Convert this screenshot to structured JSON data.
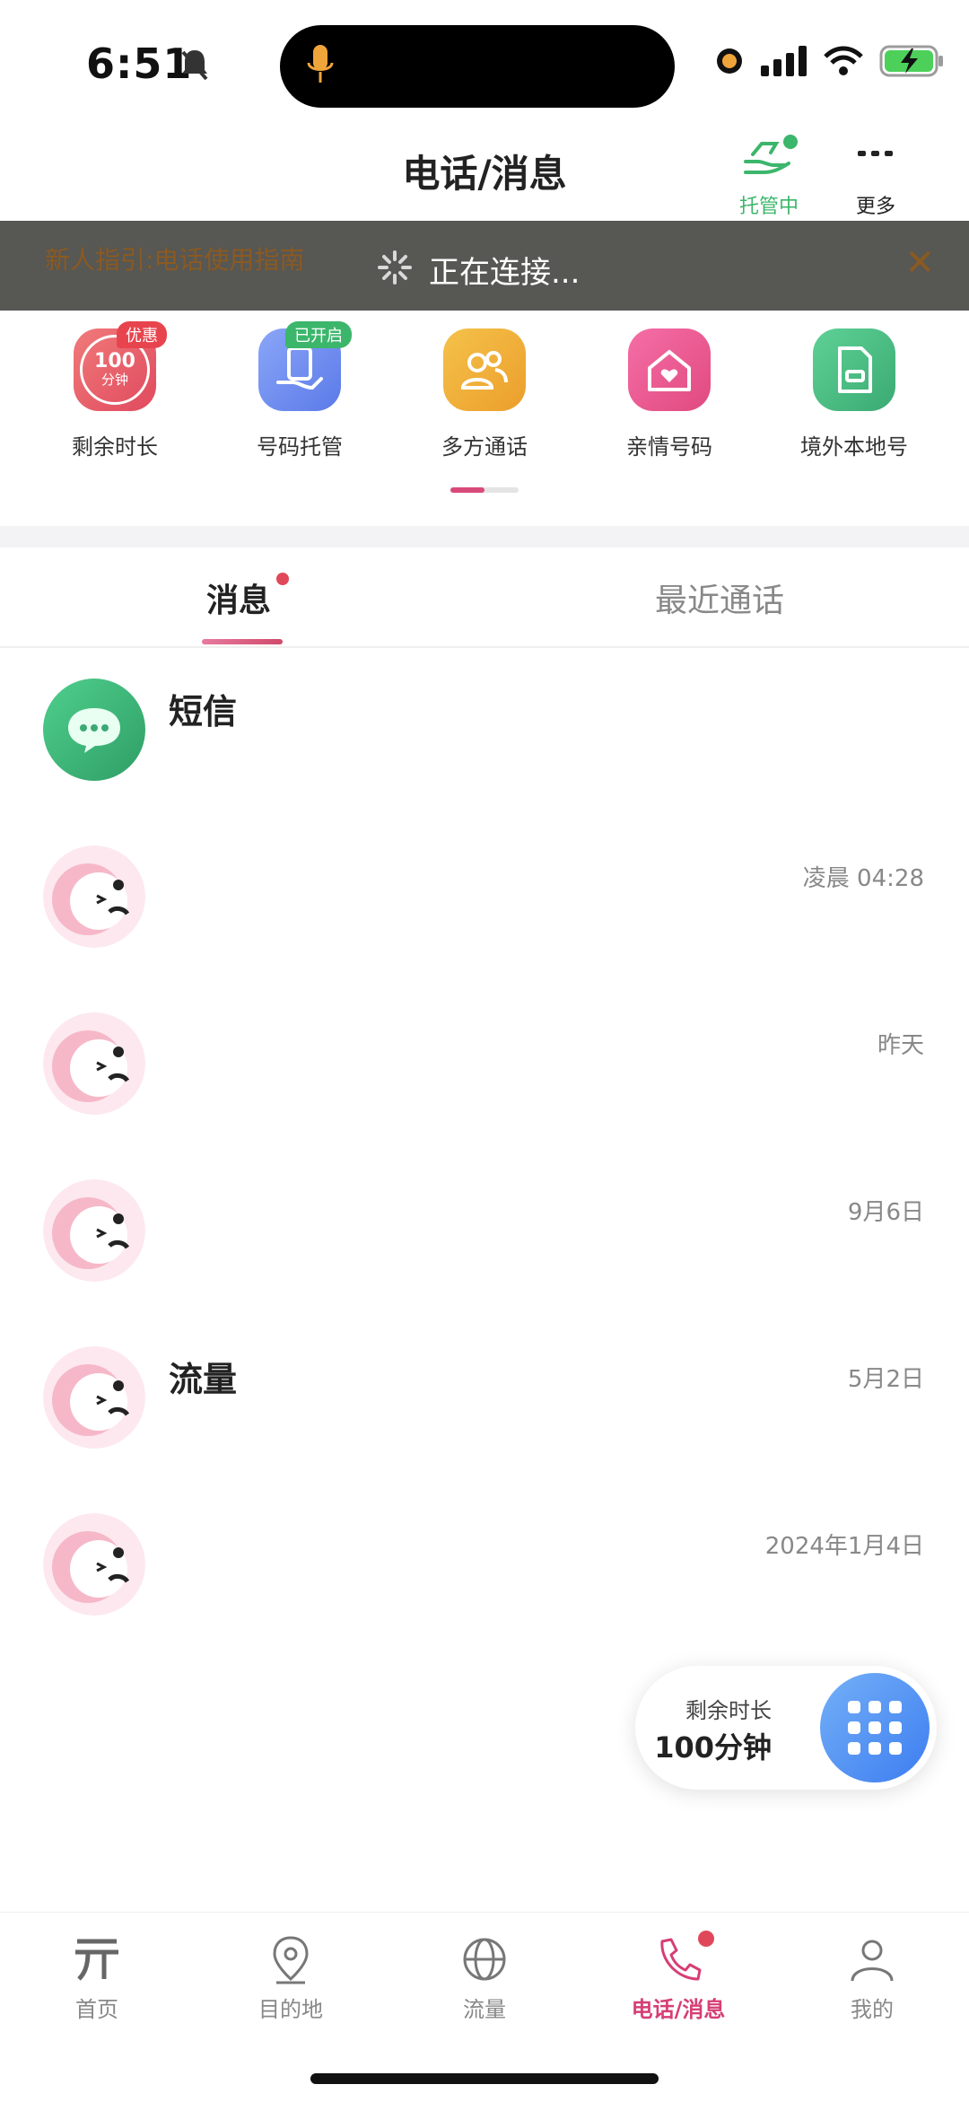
{
  "status_bar": {
    "time": "6:51"
  },
  "header": {
    "title": "电话/消息",
    "managed_label": "托管中",
    "more_label": "更多"
  },
  "toast": {
    "guide_text": "新人指引:电话使用指南",
    "text": "正在连接..."
  },
  "shortcuts": [
    {
      "label": "剩余时长",
      "icon_value": "100",
      "icon_unit": "分钟",
      "badge": "优惠",
      "color": "#e85a6a"
    },
    {
      "label": "号码托管",
      "badge": "已开启",
      "color": "#6f8cf0"
    },
    {
      "label": "多方通话",
      "color": "#f0b23c"
    },
    {
      "label": "亲情号码",
      "color": "#ec5d93"
    },
    {
      "label": "境外本地号",
      "color": "#4bbf86"
    }
  ],
  "tabs": {
    "messages": "消息",
    "recent_calls": "最近通话"
  },
  "messages": [
    {
      "title": "短信",
      "time": ""
    },
    {
      "title": "",
      "time": "凌晨 04:28"
    },
    {
      "title": "",
      "time": "昨天"
    },
    {
      "title": "",
      "time": "9月6日"
    },
    {
      "title": "流量",
      "time": "5月2日"
    },
    {
      "title": "",
      "time": "2024年1月4日"
    }
  ],
  "balance_widget": {
    "label": "剩余时长",
    "value": "100分钟"
  },
  "bottom_nav": [
    {
      "label": "首页"
    },
    {
      "label": "目的地"
    },
    {
      "label": "流量"
    },
    {
      "label": "电话/消息"
    },
    {
      "label": "我的"
    }
  ],
  "colors": {
    "accent": "#d63e75",
    "managed_green": "#3cb66b",
    "toast_bg": "#575753"
  }
}
